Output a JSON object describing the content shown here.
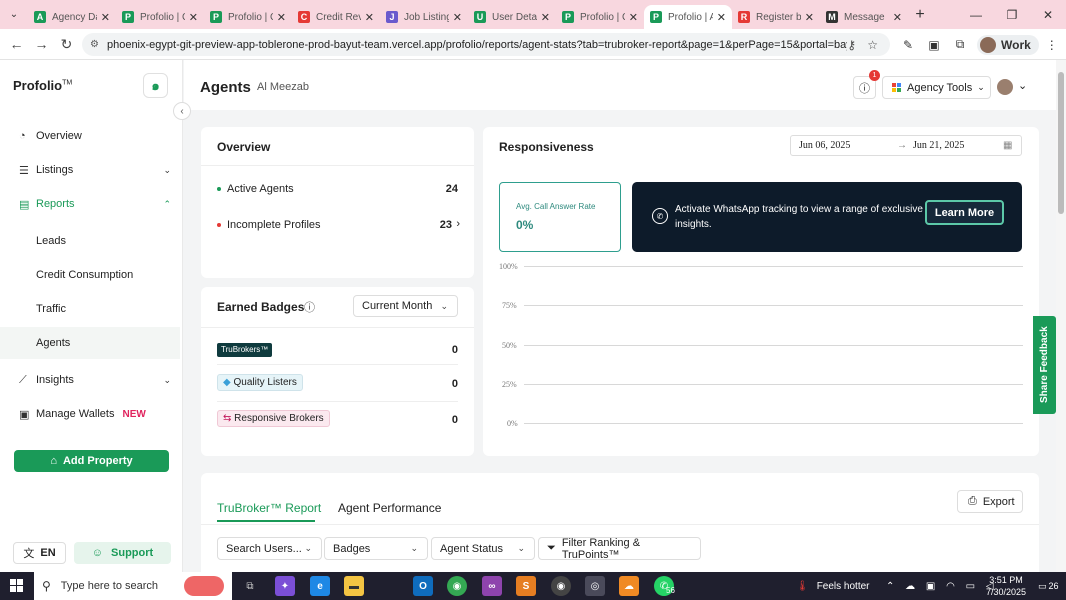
{
  "browser": {
    "tabs": [
      {
        "title": "Agency Da",
        "fav": "A",
        "color": "#1a9a58",
        "active": false
      },
      {
        "title": "Profolio | C",
        "fav": "P",
        "color": "#1a9a58",
        "active": false
      },
      {
        "title": "Profolio | C",
        "fav": "P",
        "color": "#1a9a58",
        "active": false
      },
      {
        "title": "Credit Rev",
        "fav": "C",
        "color": "#e53935",
        "active": false
      },
      {
        "title": "Job Listing",
        "fav": "J",
        "color": "#6a5acd",
        "active": false
      },
      {
        "title": "User Deta",
        "fav": "U",
        "color": "#1a9a58",
        "active": false
      },
      {
        "title": "Profolio | C",
        "fav": "P",
        "color": "#1a9a58",
        "active": false
      },
      {
        "title": "Profolio | A",
        "fav": "P",
        "color": "#1a9a58",
        "active": true
      },
      {
        "title": "Register b",
        "fav": "R",
        "color": "#e53935",
        "active": false
      },
      {
        "title": "Message",
        "fav": "M",
        "color": "#333333",
        "active": false
      }
    ],
    "url": "phoenix-egypt-git-preview-app-toblerone-prod-bayut-team.vercel.app/profolio/reports/agent-stats?tab=trubroker-report&page=1&perPage=15&portal=bayut",
    "profile": "Work"
  },
  "sidebar": {
    "logo": "Profolio",
    "logo_tm": "TM",
    "items": [
      {
        "label": "Overview",
        "icon": "◔"
      },
      {
        "label": "Listings",
        "icon": "☰"
      },
      {
        "label": "Reports",
        "icon": "▤"
      },
      {
        "label": "Leads"
      },
      {
        "label": "Credit Consumption"
      },
      {
        "label": "Traffic"
      },
      {
        "label": "Agents"
      },
      {
        "label": "Insights",
        "icon": "⟋"
      },
      {
        "label": "Manage Wallets",
        "icon": "▣",
        "badge": "NEW"
      }
    ],
    "add_property": "Add Property",
    "lang": "EN",
    "support": "Support"
  },
  "header": {
    "title": "Agents",
    "subtitle": "Al Meezab",
    "notif_count": "1",
    "agency_tools": "Agency Tools"
  },
  "overview": {
    "title": "Overview",
    "active_agents_label": "Active Agents",
    "active_agents_value": "24",
    "incomplete_label": "Incomplete Profiles",
    "incomplete_value": "23"
  },
  "badges": {
    "title": "Earned Badges",
    "period": "Current Month",
    "items": [
      {
        "label": "TruBrokers™",
        "value": "0"
      },
      {
        "label": "Quality Listers",
        "value": "0"
      },
      {
        "label": "Responsive Brokers",
        "value": "0"
      }
    ]
  },
  "responsiveness": {
    "title": "Responsiveness",
    "date_from": "Jun 06, 2025",
    "date_to": "Jun 21, 2025",
    "call_rate_label": "Avg. Call Answer Rate",
    "call_rate_value": "0%",
    "banner_text_1": "Activate WhatsApp tracking to view a range of exclusive",
    "banner_text_2": "insights.",
    "learn_more": "Learn More",
    "y_ticks": [
      "100%",
      "75%",
      "50%",
      "25%",
      "0%"
    ]
  },
  "feedback": "Share Feedback",
  "report": {
    "tabs": [
      "TruBroker™ Report",
      "Agent Performance"
    ],
    "export": "Export",
    "filters": [
      "Search Users...",
      "Badges",
      "Agent Status",
      "Filter Ranking & TruPoints™"
    ]
  },
  "taskbar": {
    "search_placeholder": "Type here to search",
    "weather": "Feels hotter",
    "time": "3:51 PM",
    "date": "7/30/2025",
    "notif": "26",
    "whatsapp_count": "56"
  }
}
